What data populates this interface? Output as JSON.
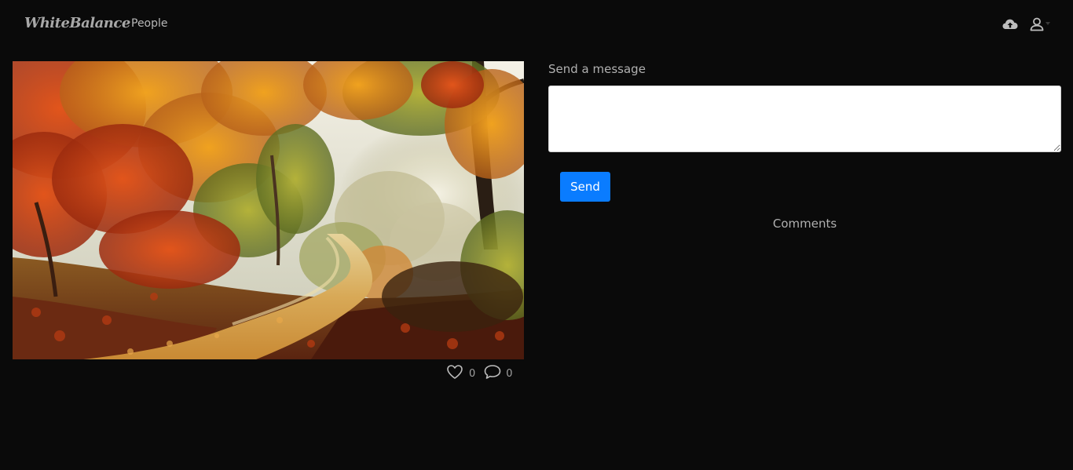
{
  "navbar": {
    "brand": "WhiteBalance",
    "links": [
      {
        "label": "People"
      }
    ],
    "icons": {
      "upload": "cloud-upload-icon",
      "user": "user-icon"
    }
  },
  "post": {
    "likes": "0",
    "comments": "0"
  },
  "message": {
    "label": "Send a message",
    "value": "",
    "placeholder": "",
    "send_label": "Send"
  },
  "comments": {
    "title": "Comments"
  },
  "colors": {
    "background": "#0a0a0a",
    "accent": "#0a7cff"
  }
}
